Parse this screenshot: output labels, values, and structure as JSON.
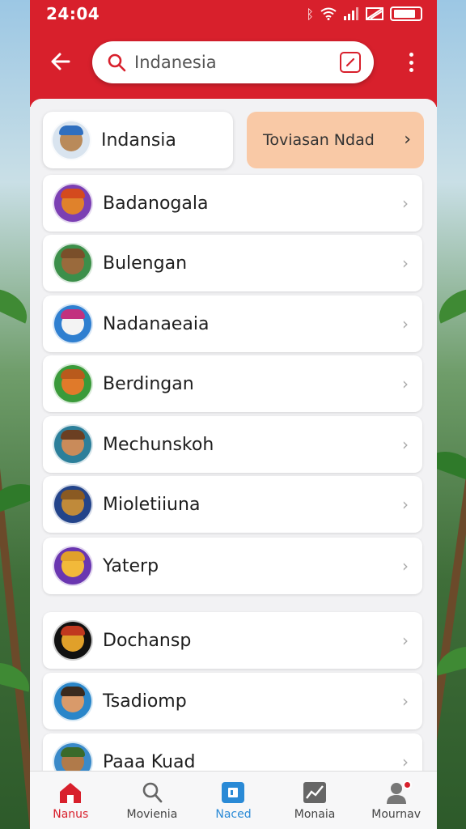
{
  "status_bar": {
    "time": "24:04",
    "icons": [
      "bluetooth-icon",
      "wifi-icon",
      "signal-icon",
      "no-sim-icon",
      "battery-icon"
    ]
  },
  "header": {
    "search_value": "Indanesia",
    "back_icon": "arrow-left-icon",
    "action_icon": "edit-icon",
    "menu_icon": "more-vertical-icon"
  },
  "top": {
    "card_label": "Indansia",
    "tag_label": "Toviasan Ndad"
  },
  "items": [
    {
      "label": "Badanogala",
      "avatar_bg": "#7b3fb3",
      "face": "#e0822b",
      "hat": "#d44a1e"
    },
    {
      "label": "Bulengan",
      "avatar_bg": "#3c8f4a",
      "face": "#9a6a3c",
      "hat": "#7a4f2a"
    },
    {
      "label": "Nadanaeaia",
      "avatar_bg": "#2f7fd0",
      "face": "#f3f3f3",
      "hat": "#c2317f"
    },
    {
      "label": "Berdingan",
      "avatar_bg": "#3a9a3a",
      "face": "#e07a2a",
      "hat": "#b95a1c"
    },
    {
      "label": "Mechunskoh",
      "avatar_bg": "#2c7f9a",
      "face": "#c98b5a",
      "hat": "#6b3f22"
    },
    {
      "label": "Mioletiiuna",
      "avatar_bg": "#23448a",
      "face": "#c08a3a",
      "hat": "#8a5a22"
    },
    {
      "label": "Yaterp",
      "avatar_bg": "#6a36b0",
      "face": "#f2b93a",
      "hat": "#e0a02a"
    },
    {
      "label": "Dochansp",
      "avatar_bg": "#111111",
      "face": "#e0a02a",
      "hat": "#c0381f"
    },
    {
      "label": "Tsadiomp",
      "avatar_bg": "#2a86c9",
      "face": "#d99a6a",
      "hat": "#3a2a1e"
    },
    {
      "label": "Paaa Kuad",
      "avatar_bg": "#3a8ac9",
      "face": "#b07a4a",
      "hat": "#3a6a2a"
    }
  ],
  "bottom_nav": [
    {
      "label": "Nanus",
      "icon": "home-icon"
    },
    {
      "label": "Movienia",
      "icon": "search-icon"
    },
    {
      "label": "Naced",
      "icon": "wallet-icon"
    },
    {
      "label": "Monaia",
      "icon": "chart-icon"
    },
    {
      "label": "Mournav",
      "icon": "profile-icon"
    }
  ]
}
